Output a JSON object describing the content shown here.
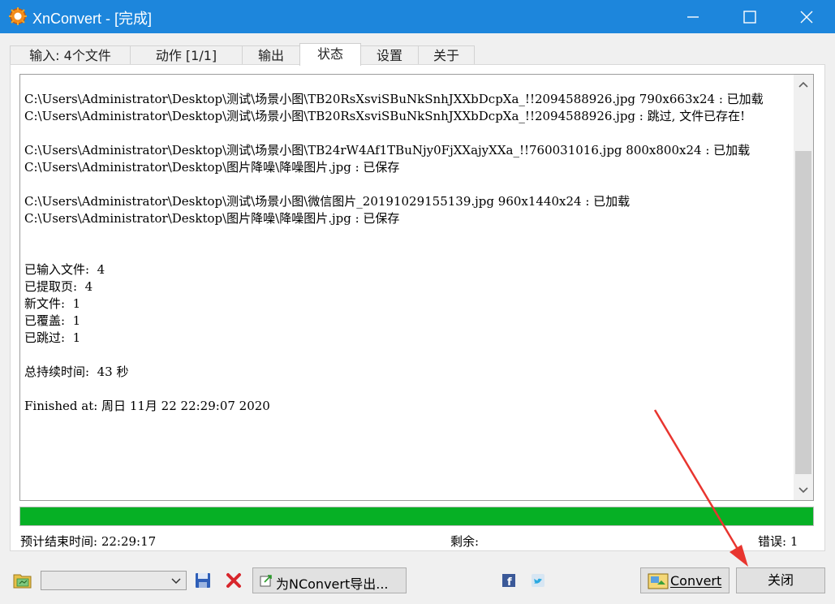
{
  "window": {
    "title": "XnConvert - [完成]"
  },
  "tabs": [
    {
      "label": "输入:  4个文件",
      "active": false
    },
    {
      "label": "动作 [1/1]",
      "active": false
    },
    {
      "label": "输出",
      "active": false
    },
    {
      "label": "状态",
      "active": true
    },
    {
      "label": "设置",
      "active": false
    },
    {
      "label": "关于",
      "active": false
    }
  ],
  "log": {
    "lines": [
      "C:\\Users\\Administrator\\Desktop\\测试\\场景小图\\TB20RsXsviSBuNkSnhJXXbDcpXa_!!2094588926.jpg 790x663x24 : 已加载",
      "C:\\Users\\Administrator\\Desktop\\测试\\场景小图\\TB20RsXsviSBuNkSnhJXXbDcpXa_!!2094588926.jpg : 跳过, 文件已存在!",
      "",
      "C:\\Users\\Administrator\\Desktop\\测试\\场景小图\\TB24rW4Af1TBuNjy0FjXXajyXXa_!!760031016.jpg 800x800x24 : 已加载",
      "C:\\Users\\Administrator\\Desktop\\图片降噪\\降噪图片.jpg : 已保存",
      "",
      "C:\\Users\\Administrator\\Desktop\\测试\\场景小图\\微信图片_20191029155139.jpg 960x1440x24 : 已加载",
      "C:\\Users\\Administrator\\Desktop\\图片降噪\\降噪图片.jpg : 已保存",
      "",
      "",
      "已输入文件:  4",
      "已提取页:  4",
      "新文件:  1",
      "已覆盖:  1",
      "已跳过:  1",
      "",
      "总持续时间:  43 秒",
      "",
      "Finished at: 周日 11月 22 22:29:07 2020"
    ]
  },
  "progress": {
    "fraction": 1.0,
    "color": "#06b025"
  },
  "status": {
    "eta_label": "预计结束时间:  22:29:17",
    "remaining_label": "剩余:",
    "errors_label": "错误:  1"
  },
  "toolbar": {
    "combo_value": "",
    "export_label": "为NConvert导出...",
    "convert_label": "Convert",
    "close_label": "关闭"
  },
  "icons": {
    "app": "xnconvert-logo-icon",
    "minimize": "minimize-icon",
    "maximize": "maximize-icon",
    "close": "close-icon",
    "folder": "folder-icon",
    "save": "save-icon",
    "delete": "delete-icon",
    "facebook": "facebook-icon",
    "twitter": "twitter-icon"
  },
  "colors": {
    "titlebar": "#1d86dc",
    "progress": "#06b025",
    "annotation_arrow": "#e8352f"
  }
}
